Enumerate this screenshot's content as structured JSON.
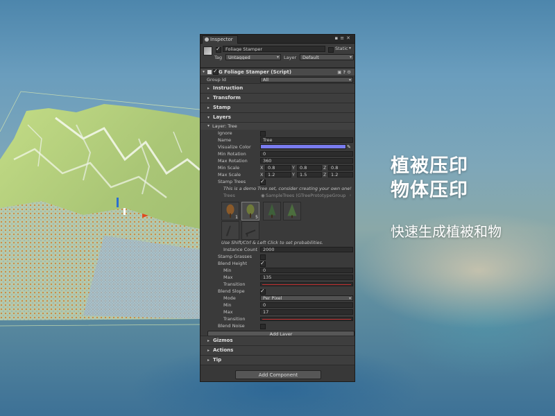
{
  "overlay": {
    "line1": "植被压印",
    "line2": "物体压印",
    "line3": "快速生成植被和物"
  },
  "inspector": {
    "tab_label": "Inspector",
    "object_name": "Foliage Stamper",
    "static_label": "Static",
    "tag_label": "Tag",
    "tag_value": "Untagged",
    "layer_label": "Layer",
    "layer_value": "Default",
    "component_title": "G Foliage Stamper (Script)",
    "group_id_label": "Group Id",
    "group_id_value": "All",
    "sections": {
      "instruction": "Instruction",
      "transform": "Transform",
      "stamp": "Stamp",
      "layers": "Layers",
      "gizmos": "Gizmos",
      "actions": "Actions",
      "tip": "Tip"
    },
    "layer": {
      "title": "Layer: Tree",
      "ignore_label": "Ignore",
      "name_label": "Name",
      "name_value": "Tree",
      "visualize_color_label": "Visualize Color",
      "visualize_color": "#7a7cf0",
      "min_rotation_label": "Min Rotation",
      "min_rotation_value": "0",
      "max_rotation_label": "Max Rotation",
      "max_rotation_value": "360",
      "min_scale_label": "Min Scale",
      "min_scale": {
        "x": "0.8",
        "y": "0.8",
        "z": "0.8"
      },
      "max_scale_label": "Max Scale",
      "max_scale": {
        "x": "1.2",
        "y": "1.5",
        "z": "1.2"
      },
      "axis": {
        "x": "X",
        "y": "Y",
        "z": "Z"
      },
      "stamp_trees_label": "Stamp Trees",
      "demo_note": "This is a demo Tree set, consider creating your own one!",
      "trees_label": "Trees",
      "trees_value": "SampleTrees (GTreePrototypeGroup",
      "thumb_counts": [
        "1",
        "5"
      ],
      "prob_note": "Use Shift/Ctrl & Left Click to set probabilities.",
      "instance_count_label": "Instance Count",
      "instance_count_value": "2000",
      "stamp_grasses_label": "Stamp Grasses",
      "blend_height_label": "Blend Height",
      "bh_min_label": "Min",
      "bh_min_value": "0",
      "bh_max_label": "Max",
      "bh_max_value": "135",
      "bh_transition_label": "Transition",
      "blend_slope_label": "Blend Slope",
      "bs_mode_label": "Mode",
      "bs_mode_value": "Per Pixel",
      "bs_min_label": "Min",
      "bs_min_value": "0",
      "bs_max_label": "Max",
      "bs_max_value": "17",
      "bs_transition_label": "Transition",
      "blend_noise_label": "Blend Noise"
    },
    "add_layer_label": "Add Layer",
    "add_component_label": "Add Component"
  },
  "colors": {
    "panel_bg": "#383838",
    "slider_red": "#c03030",
    "terrain_green": "#b8d27a"
  }
}
